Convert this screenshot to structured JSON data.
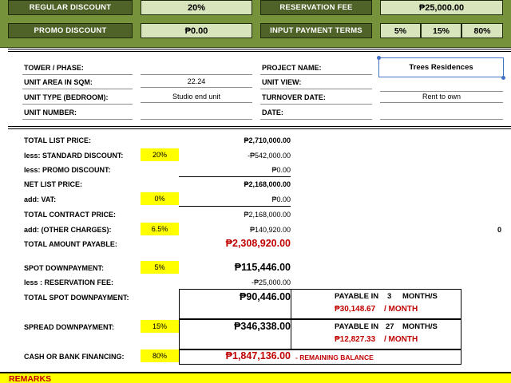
{
  "header": {
    "regular_discount_label": "REGULAR DISCOUNT",
    "regular_discount_value": "20%",
    "reservation_fee_label": "RESERVATION FEE",
    "reservation_fee_value": "₱25,000.00",
    "promo_discount_label": "PROMO DISCOUNT",
    "promo_discount_value": "₱0.00",
    "payment_terms_label": "INPUT PAYMENT TERMS",
    "payment_terms": [
      "5%",
      "15%",
      "80%"
    ]
  },
  "info": {
    "tower_label": "TOWER / PHASE:",
    "tower_value": "",
    "unit_area_label": "UNIT AREA IN SQM:",
    "unit_area_value": "22.24",
    "unit_type_label": "UNIT TYPE (BEDROOM):",
    "unit_type_value": "Studio end unit",
    "unit_number_label": "UNIT NUMBER:",
    "unit_number_value": "",
    "project_name_label": "PROJECT NAME:",
    "project_name_value": "Trees Residences",
    "unit_view_label": "UNIT VIEW:",
    "unit_view_value": "",
    "turnover_label": "TURNOVER DATE:",
    "turnover_value": "Rent to own",
    "date_label": "DATE:",
    "date_value": ""
  },
  "computation": {
    "total_list_price_label": "TOTAL LIST PRICE:",
    "total_list_price": "₱2,710,000.00",
    "std_discount_label": "less: STANDARD DISCOUNT:",
    "std_discount_pct": "20%",
    "std_discount": "-₱542,000.00",
    "promo_discount_label": "less: PROMO DISCOUNT:",
    "promo_discount": "₱0.00",
    "net_list_price_label": "NET LIST PRICE:",
    "net_list_price": "₱2,168,000.00",
    "vat_label": "add: VAT:",
    "vat_pct": "0%",
    "vat": "₱0.00",
    "total_contract_label": "TOTAL CONTRACT PRICE:",
    "total_contract": "₱2,168,000.00",
    "other_charges_label": "add: (OTHER CHARGES):",
    "other_charges_pct": "6.5%",
    "other_charges": "₱140,920.00",
    "other_charges_side": "0",
    "total_payable_label": "TOTAL AMOUNT PAYABLE:",
    "total_payable": "₱2,308,920.00",
    "spot_dp_label": "SPOT DOWNPAYMENT:",
    "spot_dp_pct": "5%",
    "spot_dp": "₱115,446.00",
    "less_reservation_label": "less : RESERVATION FEE:",
    "less_reservation": "-₱25,000.00",
    "total_spot_label": "TOTAL SPOT DOWNPAYMENT:",
    "total_spot": "₱90,446.00",
    "spot_payable_in": "PAYABLE IN",
    "spot_months": "3",
    "spot_months_unit": "MONTH/S",
    "spot_monthly": "₱30,148.67",
    "per_month": "/ MONTH",
    "spread_dp_label": "SPREAD DOWNPAYMENT:",
    "spread_dp_pct": "15%",
    "spread_dp": "₱346,338.00",
    "spread_payable_in": "PAYABLE IN",
    "spread_months": "27",
    "spread_months_unit": "MONTH/S",
    "spread_monthly": "₱12,827.33",
    "spread_per_month": "/ MONTH",
    "financing_label": "CASH OR BANK FINANCING:",
    "financing_pct": "80%",
    "financing": "₱1,847,136.00",
    "remaining_label": "- REMAINING BALANCE"
  },
  "remarks": {
    "label": "REMARKS"
  }
}
